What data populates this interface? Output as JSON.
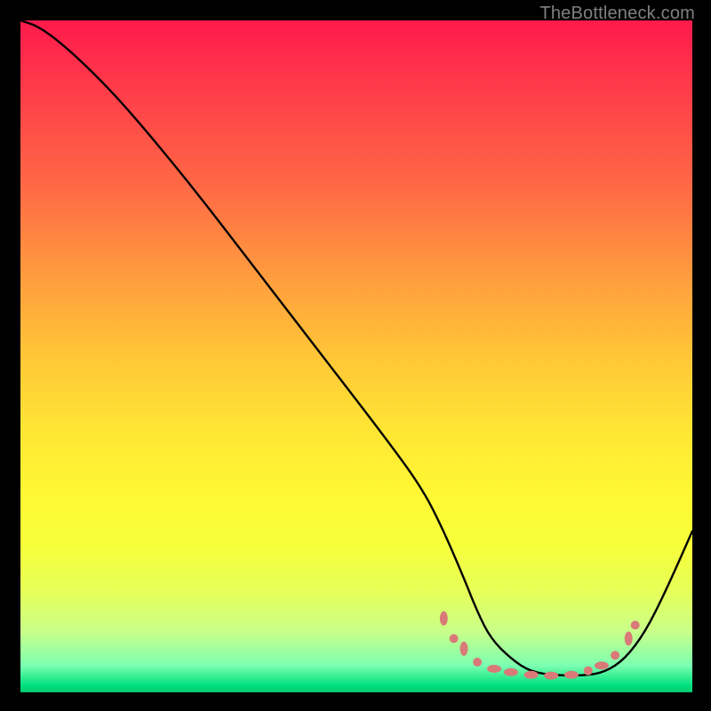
{
  "watermark": "TheBottleneck.com",
  "chart_data": {
    "type": "line",
    "title": "",
    "xlabel": "",
    "ylabel": "",
    "xlim": [
      0,
      100
    ],
    "ylim": [
      0,
      100
    ],
    "grid": false,
    "legend": false,
    "series": [
      {
        "name": "bottleneck-curve",
        "x": [
          0,
          3,
          8,
          15,
          25,
          35,
          45,
          55,
          60,
          63,
          66,
          68,
          70,
          73,
          76,
          80,
          84,
          87,
          90,
          93,
          96,
          100
        ],
        "y": [
          100,
          99,
          95,
          88,
          76,
          63,
          50,
          37,
          30,
          24,
          17,
          12,
          8,
          5,
          3,
          2.5,
          2.5,
          3,
          5,
          9,
          15,
          24
        ]
      }
    ],
    "markers": {
      "name": "highlight-dots",
      "color_hex": "#d97a78",
      "points": [
        {
          "x": 63.0,
          "y": 11.0,
          "shape": "oval-v"
        },
        {
          "x": 64.5,
          "y": 8.0,
          "shape": "dot"
        },
        {
          "x": 66.0,
          "y": 6.5,
          "shape": "oval-v"
        },
        {
          "x": 68.0,
          "y": 4.5,
          "shape": "dot"
        },
        {
          "x": 70.5,
          "y": 3.5,
          "shape": "oval-h"
        },
        {
          "x": 73.0,
          "y": 3.0,
          "shape": "oval-h"
        },
        {
          "x": 76.0,
          "y": 2.6,
          "shape": "oval-h"
        },
        {
          "x": 79.0,
          "y": 2.5,
          "shape": "oval-h"
        },
        {
          "x": 82.0,
          "y": 2.6,
          "shape": "oval-h"
        },
        {
          "x": 84.5,
          "y": 3.2,
          "shape": "dot"
        },
        {
          "x": 86.5,
          "y": 4.0,
          "shape": "oval-h"
        },
        {
          "x": 88.5,
          "y": 5.5,
          "shape": "dot"
        },
        {
          "x": 90.5,
          "y": 8.0,
          "shape": "oval-v"
        },
        {
          "x": 91.5,
          "y": 10.0,
          "shape": "dot"
        }
      ]
    },
    "background_gradient": {
      "top_hex": "#ff1a4d",
      "mid_hex": "#ffe335",
      "bottom_hex": "#00c86e"
    }
  }
}
